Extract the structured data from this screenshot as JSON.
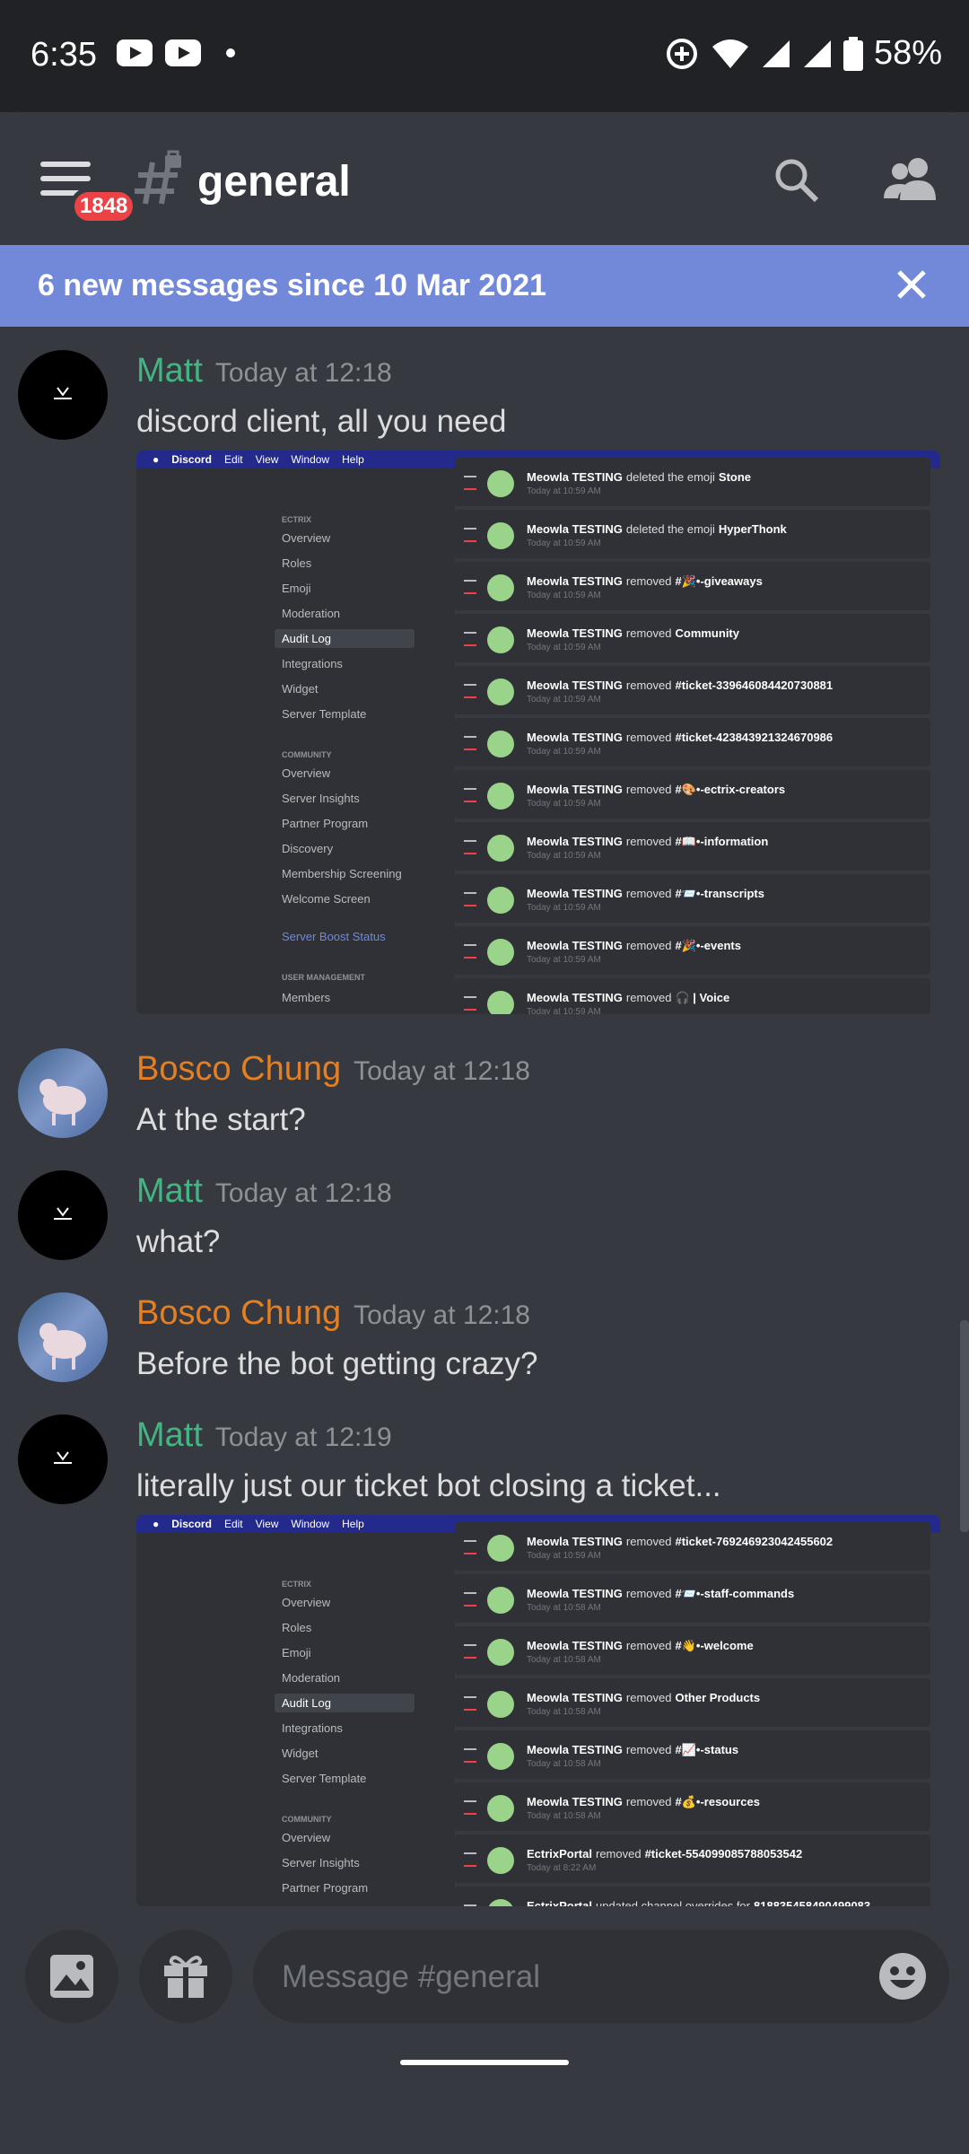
{
  "status_bar": {
    "time": "6:35",
    "battery": "58%",
    "icons": [
      "youtube-icon",
      "youtube-icon",
      "dot-icon",
      "data-saver-icon",
      "wifi-icon",
      "signal-icon",
      "signal-icon",
      "battery-icon"
    ]
  },
  "header": {
    "badge_count": "1848",
    "channel_name": "general",
    "icons": [
      "menu-icon",
      "locked-hash-icon",
      "search-icon",
      "members-icon"
    ]
  },
  "banner": {
    "text": "6 new messages since 10 Mar 2021"
  },
  "messages": [
    {
      "author": "Matt",
      "time": "Today at 12:18",
      "content": "discord client, all you need"
    },
    {
      "author": "Bosco Chung",
      "time": "Today at 12:18",
      "content": "At the start?"
    },
    {
      "author": "Matt",
      "time": "Today at 12:18",
      "content": "what?"
    },
    {
      "author": "Bosco Chung",
      "time": "Today at 12:18",
      "content": "Before the bot getting crazy?"
    },
    {
      "author": "Matt",
      "time": "Today at 12:19",
      "content": "literally just our ticket bot closing a ticket..."
    }
  ],
  "attachment": {
    "menu": [
      "Discord",
      "Edit",
      "View",
      "Window",
      "Help"
    ],
    "sidebar_sections": {
      "ectrix": "ECTRIX",
      "community": "COMMUNITY",
      "boost": "Server Boost Status",
      "user_management": "USER MANAGEMENT"
    },
    "sidebar_items_1": [
      "Overview",
      "Roles",
      "Emoji",
      "Moderation",
      "Audit Log",
      "Integrations",
      "Widget",
      "Server Template"
    ],
    "sidebar_items_2": [
      "Overview",
      "Server Insights",
      "Partner Program",
      "Discovery",
      "Membership Screening",
      "Welcome Screen"
    ],
    "members_item": "Members",
    "log1": [
      {
        "user": "Meowla TESTING",
        "action": "deleted the emoji",
        "target": "Stone",
        "time": "Today at 10:59 AM"
      },
      {
        "user": "Meowla TESTING",
        "action": "deleted the emoji",
        "target": "HyperThonk",
        "time": "Today at 10:59 AM"
      },
      {
        "user": "Meowla TESTING",
        "action": "removed",
        "target": "#🎉•-giveaways",
        "time": "Today at 10:59 AM"
      },
      {
        "user": "Meowla TESTING",
        "action": "removed",
        "target": "Community",
        "time": "Today at 10:59 AM"
      },
      {
        "user": "Meowla TESTING",
        "action": "removed",
        "target": "#ticket-339646084420730881",
        "time": "Today at 10:59 AM"
      },
      {
        "user": "Meowla TESTING",
        "action": "removed",
        "target": "#ticket-423843921324670986",
        "time": "Today at 10:59 AM"
      },
      {
        "user": "Meowla TESTING",
        "action": "removed",
        "target": "#🎨•-ectrix-creators",
        "time": "Today at 10:59 AM"
      },
      {
        "user": "Meowla TESTING",
        "action": "removed",
        "target": "#📖•-information",
        "time": "Today at 10:59 AM"
      },
      {
        "user": "Meowla TESTING",
        "action": "removed",
        "target": "#📨•-transcripts",
        "time": "Today at 10:59 AM"
      },
      {
        "user": "Meowla TESTING",
        "action": "removed",
        "target": "#🎉•-events",
        "time": "Today at 10:59 AM"
      },
      {
        "user": "Meowla TESTING",
        "action": "removed",
        "target": "🎧 | Voice",
        "time": "Today at 10:59 AM"
      }
    ],
    "log2": [
      {
        "user": "Meowla TESTING",
        "action": "removed",
        "target": "#ticket-769246923042455602",
        "time": "Today at 10:59 AM"
      },
      {
        "user": "Meowla TESTING",
        "action": "removed",
        "target": "#📨•-staff-commands",
        "time": "Today at 10:58 AM"
      },
      {
        "user": "Meowla TESTING",
        "action": "removed",
        "target": "#👋•-welcome",
        "time": "Today at 10:58 AM"
      },
      {
        "user": "Meowla TESTING",
        "action": "removed",
        "target": "Other Products",
        "time": "Today at 10:58 AM"
      },
      {
        "user": "Meowla TESTING",
        "action": "removed",
        "target": "#📈•-status",
        "time": "Today at 10:58 AM"
      },
      {
        "user": "Meowla TESTING",
        "action": "removed",
        "target": "#💰•-resources",
        "time": "Today at 10:58 AM"
      },
      {
        "user": "EctrixPortal",
        "action": "removed",
        "target": "#ticket-554099085788053542",
        "time": "Today at 8:22 AM"
      },
      {
        "user": "EctrixPortal",
        "action": "updated channel overrides for",
        "target": "818835458490499083",
        "time": ""
      }
    ]
  },
  "composer": {
    "placeholder": "Message #general",
    "icons": [
      "image-icon",
      "gift-icon",
      "emoji-icon"
    ]
  },
  "colors": {
    "background": "#36393f",
    "banner": "#7289da",
    "matt": "#43b581",
    "bosco": "#e67e22",
    "badge": "#ed4245"
  }
}
